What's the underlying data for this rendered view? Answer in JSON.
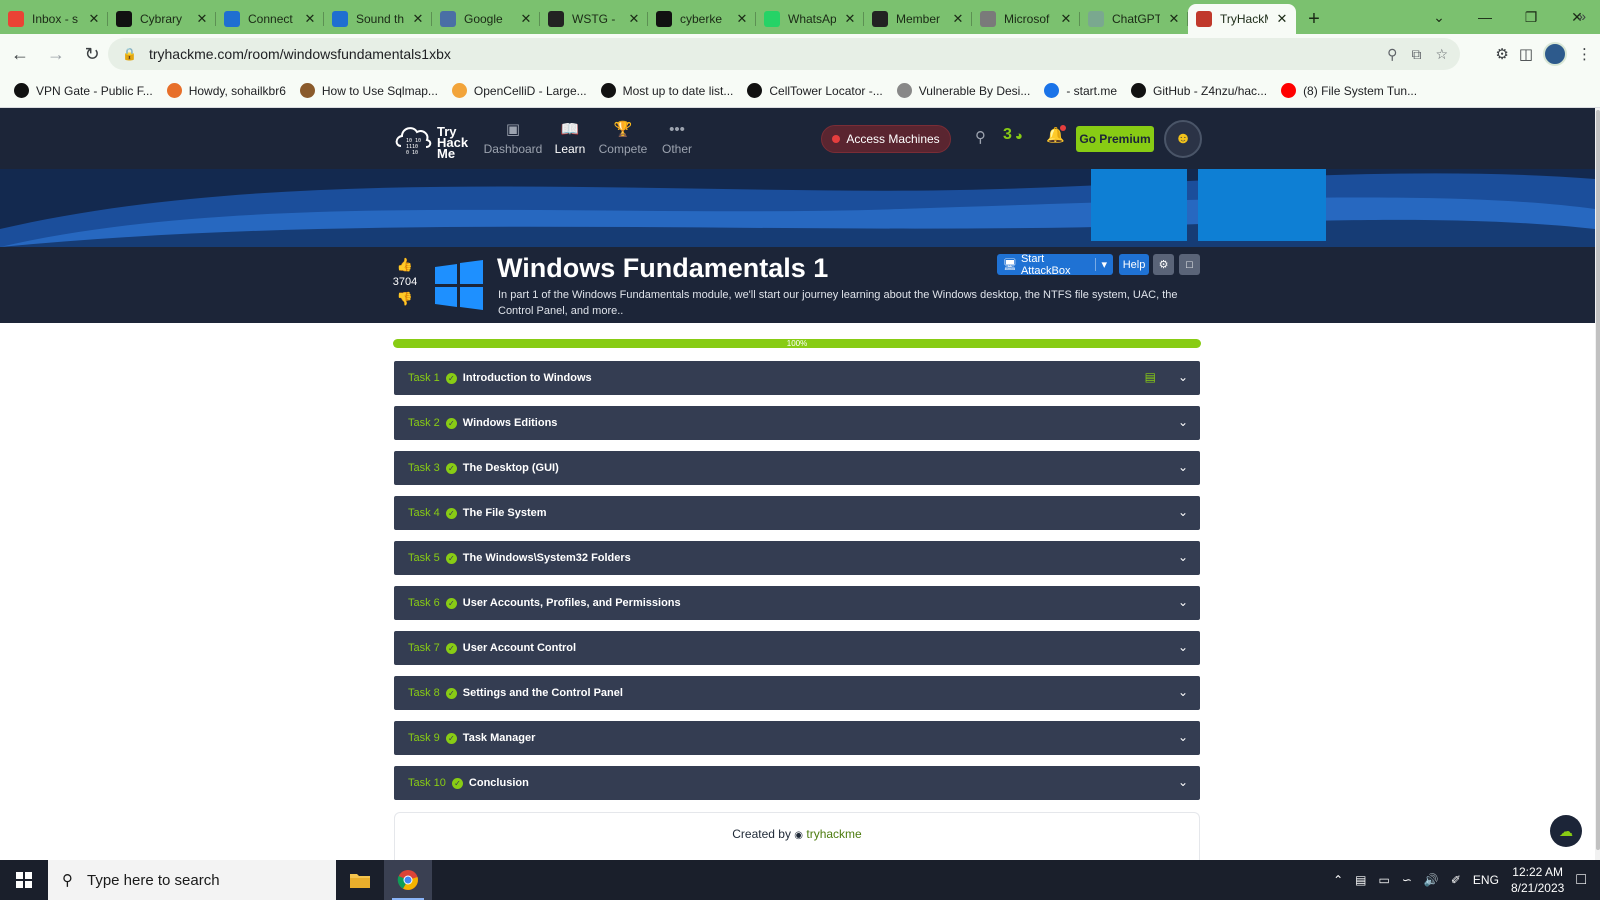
{
  "browser": {
    "tabs": [
      {
        "title": "Inbox - s",
        "favicon": "gmail-icon",
        "color": "#ea4335"
      },
      {
        "title": "Cybrary",
        "favicon": "cybrary-icon",
        "color": "#111111"
      },
      {
        "title": "Connect",
        "favicon": "c-icon",
        "color": "#1f6fd1"
      },
      {
        "title": "Sound th",
        "favicon": "c-icon",
        "color": "#1f6fd1"
      },
      {
        "title": "Google",
        "favicon": "google-icon",
        "color": "#4a6fa5"
      },
      {
        "title": "WSTG -",
        "favicon": "owasp-icon",
        "color": "#222222"
      },
      {
        "title": "cyberke",
        "favicon": "github-icon",
        "color": "#111111"
      },
      {
        "title": "WhatsAp",
        "favicon": "whatsapp-icon",
        "color": "#25d366"
      },
      {
        "title": "Member",
        "favicon": "check-icon",
        "color": "#222222"
      },
      {
        "title": "Microsof",
        "favicon": "globe-icon",
        "color": "#7a7a7a"
      },
      {
        "title": "ChatGPT",
        "favicon": "openai-icon",
        "color": "#7aa88f"
      },
      {
        "title": "TryHackM",
        "favicon": "thm-icon",
        "color": "#c0392b",
        "active": true
      }
    ],
    "url": "tryhackme.com/room/windowsfundamentals1xbx",
    "bookmarks": [
      {
        "label": "VPN Gate - Public F...",
        "color": "#111111"
      },
      {
        "label": "Howdy, sohailkbr6",
        "color": "#e76f2a"
      },
      {
        "label": "How to Use Sqlmap...",
        "color": "#8a5a2b"
      },
      {
        "label": "OpenCelliD - Large...",
        "color": "#f2a43a"
      },
      {
        "label": "Most up to date list...",
        "color": "#111111"
      },
      {
        "label": "CellTower Locator -...",
        "color": "#111111"
      },
      {
        "label": "Vulnerable By Desi...",
        "color": "#888888"
      },
      {
        "label": "- start.me",
        "color": "#1a73e8"
      },
      {
        "label": "GitHub - Z4nzu/hac...",
        "color": "#111111"
      },
      {
        "label": "(8) File System Tun...",
        "color": "#ff0000"
      }
    ]
  },
  "thm": {
    "logo_lines": [
      "Try",
      "Hack",
      "Me"
    ],
    "nav": [
      {
        "label": "Dashboard",
        "icon": "dashboard-icon"
      },
      {
        "label": "Learn",
        "icon": "book-icon",
        "active": true
      },
      {
        "label": "Compete",
        "icon": "trophy-icon"
      },
      {
        "label": "Other",
        "icon": "more-icon"
      }
    ],
    "access_label": "Access Machines",
    "streak": "3",
    "premium_label": "Go Premium"
  },
  "room": {
    "votes": "3704",
    "title": "Windows Fundamentals 1",
    "description": "In part 1 of the Windows Fundamentals module, we'll start our journey learning about the Windows desktop, the NTFS file system, UAC, the Control Panel, and more..",
    "attackbox_label": "Start AttackBox",
    "help_label": "Help",
    "progress_label": "100%",
    "progress": 1.0
  },
  "tasks": [
    {
      "num": "Task 1",
      "title": "Introduction to Windows",
      "has_notes": true
    },
    {
      "num": "Task 2",
      "title": "Windows Editions"
    },
    {
      "num": "Task 3",
      "title": "The Desktop (GUI)"
    },
    {
      "num": "Task 4",
      "title": "The File System"
    },
    {
      "num": "Task 5",
      "title": "The Windows\\System32 Folders"
    },
    {
      "num": "Task 6",
      "title": "User Accounts, Profiles, and Permissions"
    },
    {
      "num": "Task 7",
      "title": "User Account Control"
    },
    {
      "num": "Task 8",
      "title": "Settings and the Control Panel"
    },
    {
      "num": "Task 9",
      "title": "Task Manager"
    },
    {
      "num": "Task 10",
      "title": "Conclusion"
    }
  ],
  "footer": {
    "created_prefix": "Created by",
    "author": "tryhackme"
  },
  "taskbar": {
    "search_placeholder": "Type here to search",
    "language": "ENG",
    "time": "12:22 AM",
    "date": "8/21/2023"
  },
  "colors": {
    "thm_dark": "#1c2538",
    "task_bg": "#343d52",
    "accent_green": "#88cc14",
    "tab_bar": "#7bc16f"
  }
}
